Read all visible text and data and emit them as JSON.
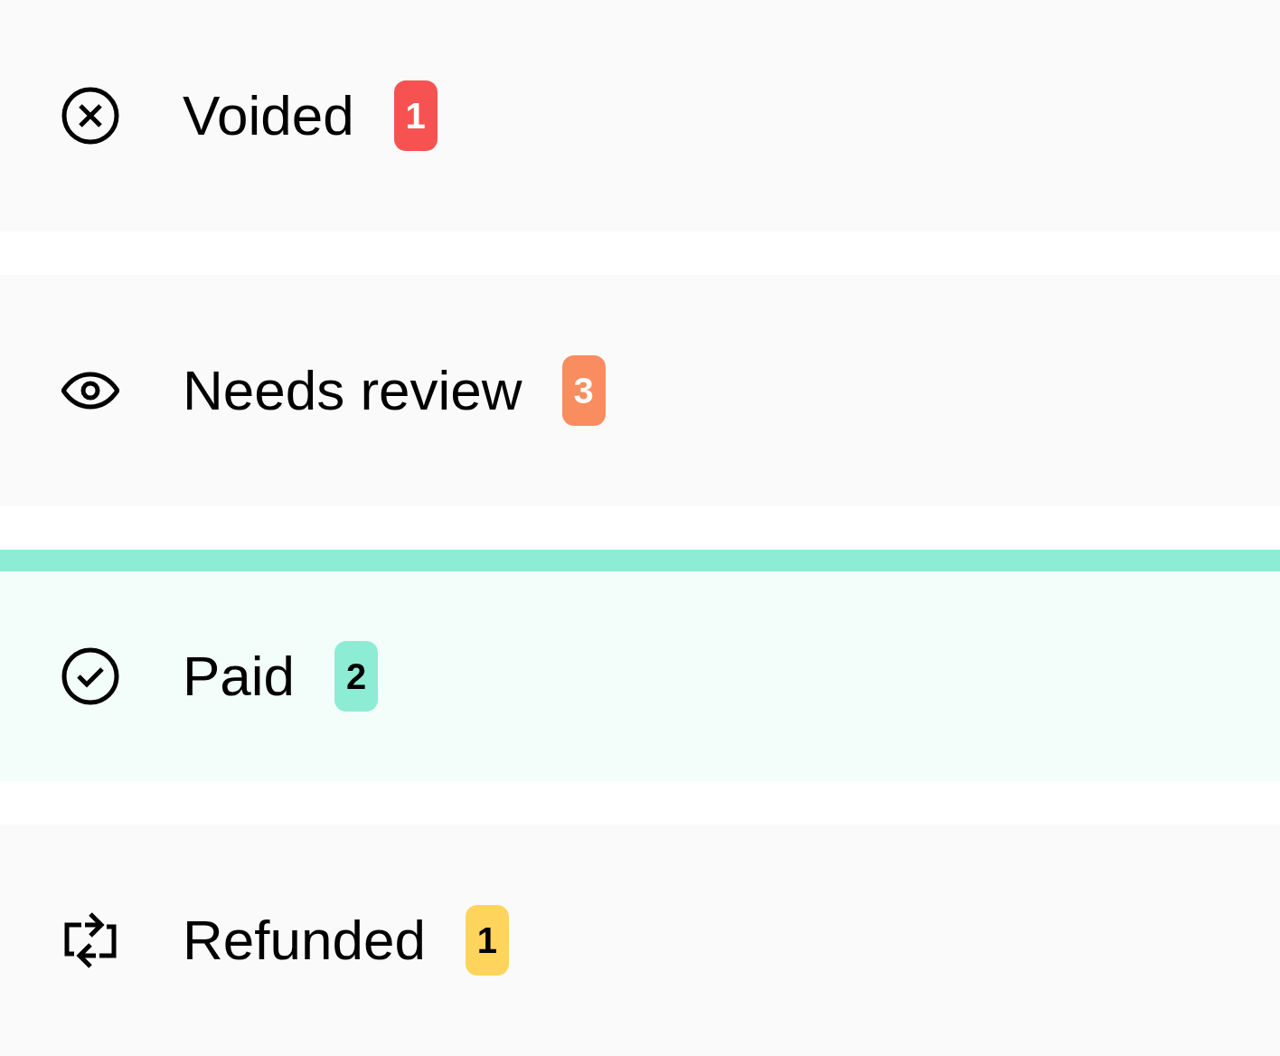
{
  "status_list": [
    {
      "kind": "voided",
      "label": "Voided",
      "count": "1",
      "color": "#f75252",
      "selected": false
    },
    {
      "kind": "review",
      "label": "Needs review",
      "count": "3",
      "color": "#f98d5f",
      "selected": false
    },
    {
      "kind": "paid",
      "label": "Paid",
      "count": "2",
      "color": "#8decd4",
      "selected": true
    },
    {
      "kind": "refunded",
      "label": "Refunded",
      "count": "1",
      "color": "#fed45c",
      "selected": false
    }
  ]
}
